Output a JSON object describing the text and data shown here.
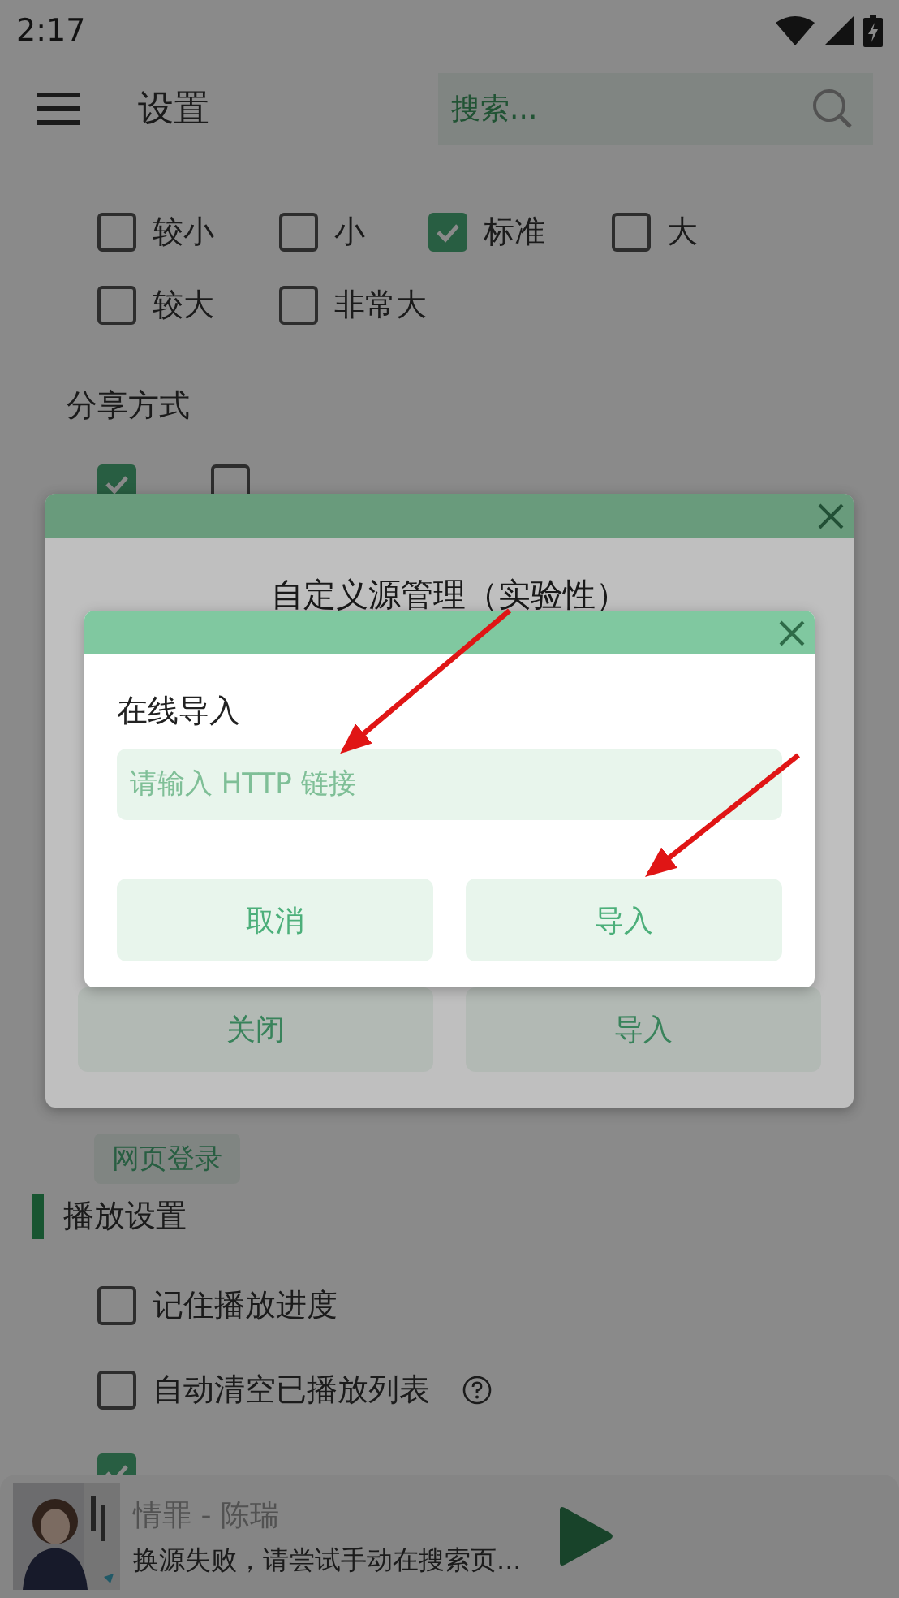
{
  "status_bar": {
    "time": "2:17"
  },
  "header": {
    "title": "设置",
    "search": {
      "placeholder": "搜索..."
    }
  },
  "font_size_options": [
    {
      "label": "较小",
      "checked": false
    },
    {
      "label": "小",
      "checked": false
    },
    {
      "label": "标准",
      "checked": true
    },
    {
      "label": "大",
      "checked": false
    },
    {
      "label": "较大",
      "checked": false
    },
    {
      "label": "非常大",
      "checked": false
    }
  ],
  "share_section": {
    "title": "分享方式",
    "options": [
      {
        "checked": true
      },
      {
        "checked": false
      }
    ]
  },
  "web_login_button": "网页登录",
  "playback_section": {
    "title": "播放设置",
    "options": [
      {
        "label": "记住播放进度",
        "checked": false,
        "help": false
      },
      {
        "label": "自动清空已播放列表",
        "checked": false,
        "help": true
      },
      {
        "checked": true,
        "help": false
      }
    ]
  },
  "player": {
    "title": "情罪 - 陈瑞",
    "status": "换源失败，请尝试手动在搜索页...",
    "playing": false
  },
  "outer_dialog": {
    "title": "自定义源管理（实验性）",
    "buttons": [
      "关闭",
      "导入"
    ]
  },
  "inner_dialog": {
    "title": "在线导入",
    "input": {
      "placeholder": "请输入 HTTP 链接"
    },
    "buttons": [
      "取消",
      "导入"
    ]
  }
}
